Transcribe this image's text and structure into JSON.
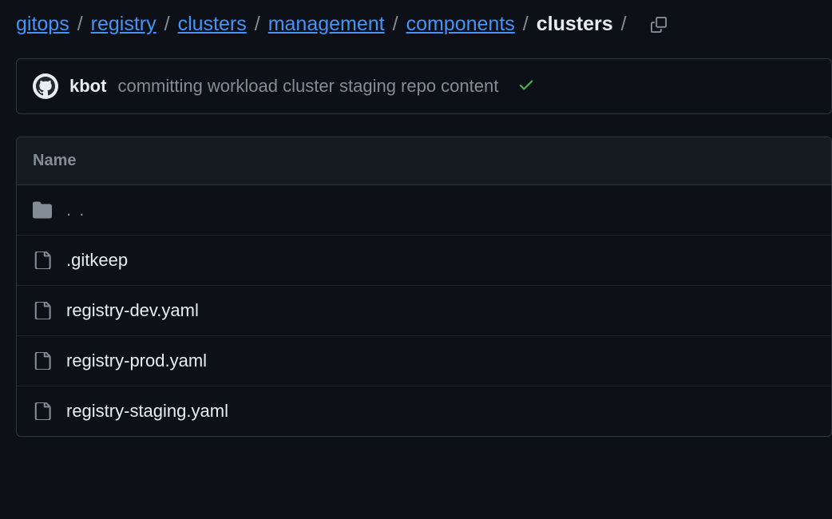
{
  "breadcrumb": {
    "items": [
      {
        "label": "gitops",
        "link": true
      },
      {
        "label": "registry",
        "link": true
      },
      {
        "label": "clusters",
        "link": true
      },
      {
        "label": "management",
        "link": true
      },
      {
        "label": "components",
        "link": true
      },
      {
        "label": "clusters",
        "link": false
      }
    ],
    "separator": "/"
  },
  "commit": {
    "author": "kbot",
    "message": "committing workload cluster staging repo content"
  },
  "table": {
    "header": "Name",
    "parent_dir": ". .",
    "files": [
      {
        "name": ".gitkeep",
        "type": "file"
      },
      {
        "name": "registry-dev.yaml",
        "type": "file"
      },
      {
        "name": "registry-prod.yaml",
        "type": "file"
      },
      {
        "name": "registry-staging.yaml",
        "type": "file"
      }
    ]
  }
}
